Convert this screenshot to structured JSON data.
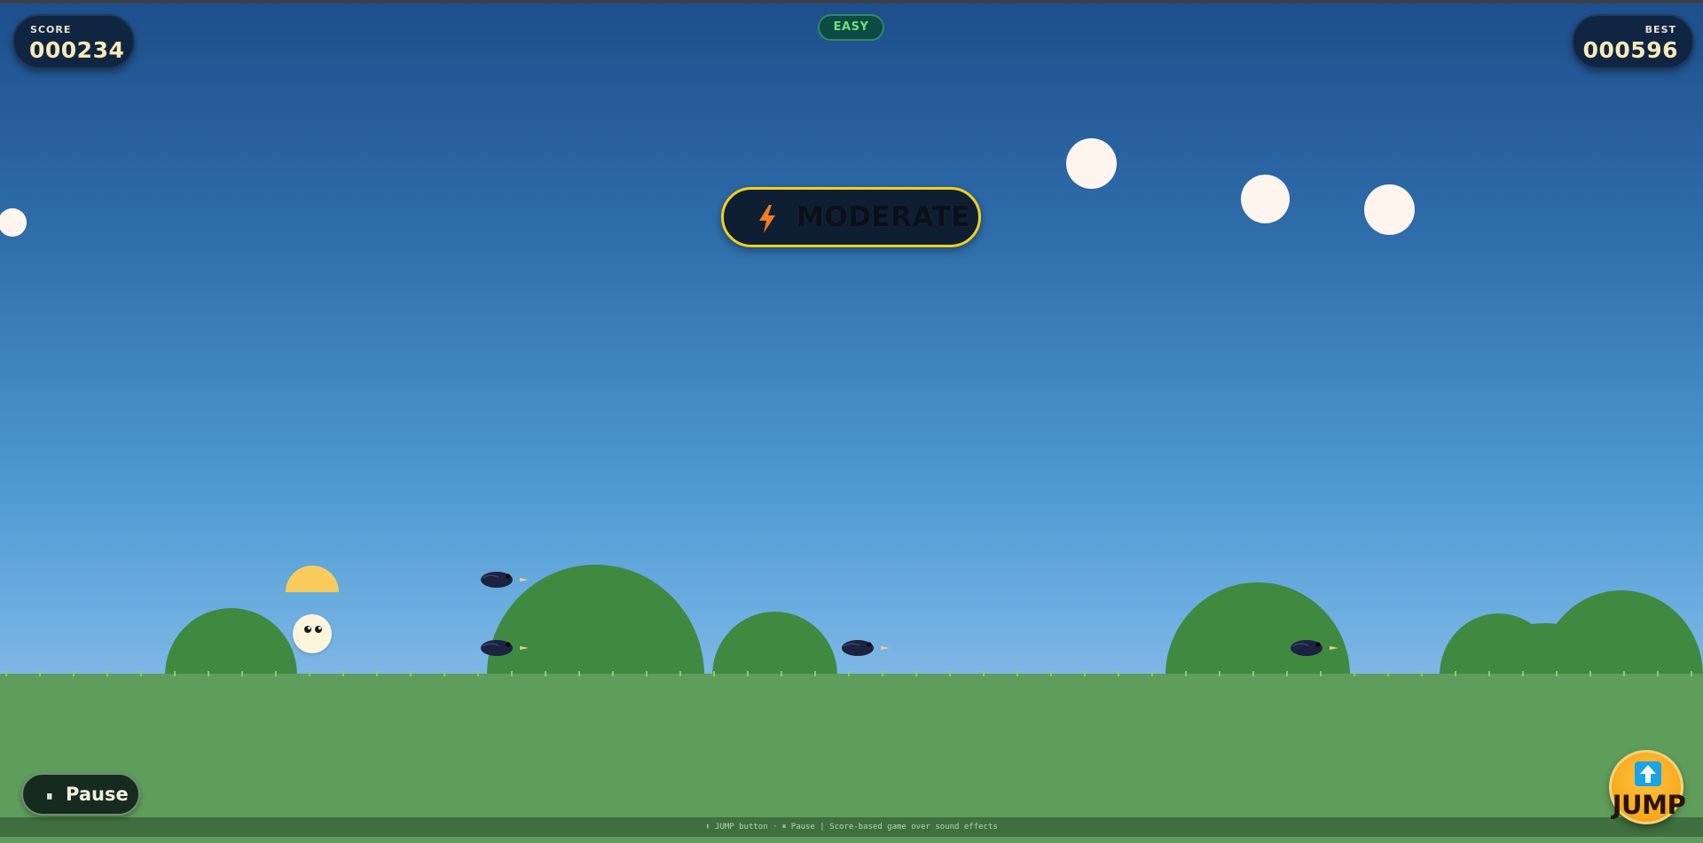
{
  "hud": {
    "score_label": "SCORE",
    "score_value": "000234",
    "best_label": "BEST",
    "best_value": "000596"
  },
  "difficulty_badge": "EASY",
  "banner": {
    "icon": "lightning-bolt-icon",
    "text": "MODERATE"
  },
  "controls": {
    "pause_icon": "⏸",
    "pause_label": "Pause",
    "jump_icon": "up-arrow-icon",
    "jump_label": "JUMP"
  },
  "footer_help": "⬆ JUMP button · ⏸ Pause | Score-based game over sound effects",
  "colors": {
    "sky_top": "#1d4f8c",
    "sky_bottom": "#7db7e6",
    "ground": "#5e9d5c",
    "hill": "#3f8a40",
    "banner_border": "#f3cf1e",
    "jump_button": "#f7a81b"
  }
}
